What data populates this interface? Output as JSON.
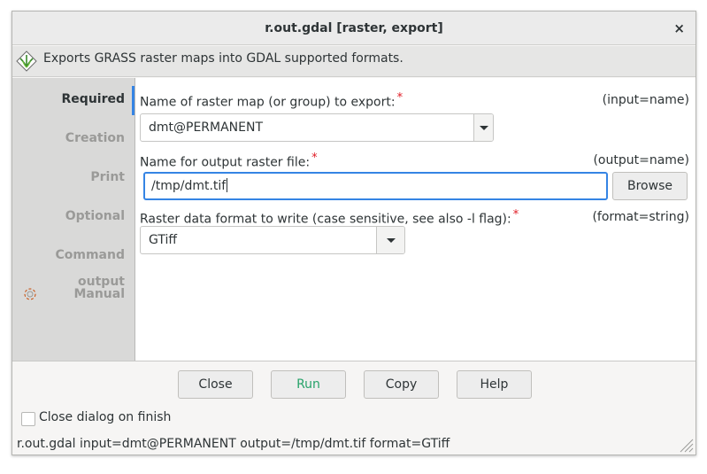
{
  "window": {
    "title": "r.out.gdal [raster, export]",
    "close_glyph": "×",
    "description": "Exports GRASS raster maps into GDAL supported formats."
  },
  "sidebar": {
    "items": [
      {
        "label": "Required",
        "active": true
      },
      {
        "label": "Creation",
        "active": false
      },
      {
        "label": "Print",
        "active": false
      },
      {
        "label": "Optional",
        "active": false
      },
      {
        "label": "Command output",
        "active": false
      },
      {
        "label": "Manual",
        "active": false,
        "icon": "lifebuoy-icon"
      }
    ]
  },
  "form": {
    "input": {
      "label": "Name of raster map (or group) to export:",
      "required_mark": "*",
      "param": "(input=name)",
      "value": "dmt@PERMANENT"
    },
    "output": {
      "label": "Name for output raster file:",
      "required_mark": "*",
      "param": "(output=name)",
      "value": "/tmp/dmt.tif",
      "browse_label": "Browse"
    },
    "format": {
      "label": "Raster data format to write (case sensitive, see also -l flag):",
      "required_mark": "*",
      "param": "(format=string)",
      "value": "GTiff"
    }
  },
  "buttons": {
    "close": "Close",
    "run": "Run",
    "copy": "Copy",
    "help": "Help"
  },
  "close_on_finish": {
    "label": "Close dialog on finish",
    "checked": false
  },
  "status_command": "r.out.gdal input=dmt@PERMANENT output=/tmp/dmt.tif format=GTiff",
  "colors": {
    "accent": "#3584e4",
    "required": "#e01b24",
    "run_text": "#26a269"
  }
}
